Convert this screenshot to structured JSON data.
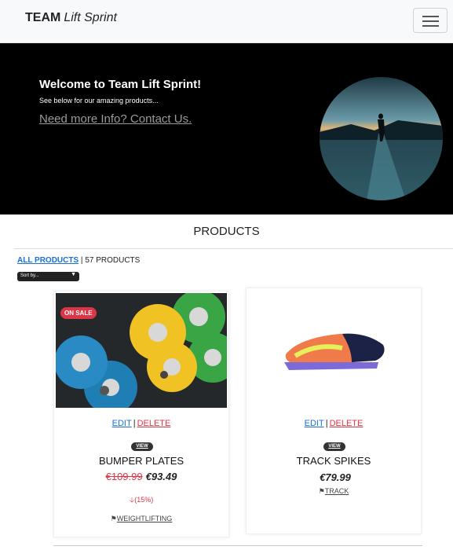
{
  "navbar": {
    "brand_bold": "TEAM",
    "brand_italic": "Lift Sprint"
  },
  "hero": {
    "title": "Welcome to Team Lift Sprint!",
    "subtitle": "See below for our amazing products...",
    "link": "Need more Info? Contact Us."
  },
  "products": {
    "heading": "PRODUCTS",
    "all_link": "ALL PRODUCTS",
    "separator": " | ",
    "count": "57 PRODUCTS",
    "sort_label": "Sort by...",
    "items": [
      {
        "badge": "ON SALE",
        "edit": "EDIT",
        "sep": "|",
        "delete": "DELETE",
        "view": "VIEW",
        "name": "BUMPER PLATES",
        "old_price": "€109.99",
        "price": "€93.49",
        "discount": "(15%)",
        "category": "WEIGHTLIFTING"
      },
      {
        "edit": "EDIT",
        "sep": "|",
        "delete": "DELETE",
        "view": "VIEW",
        "name": "TRACK SPIKES",
        "price": "€79.99",
        "category": "TRACK"
      }
    ]
  },
  "colors": {
    "link_blue": "#1a6fd6",
    "sale_red": "#dc3545",
    "hero_bg": "#000000"
  }
}
